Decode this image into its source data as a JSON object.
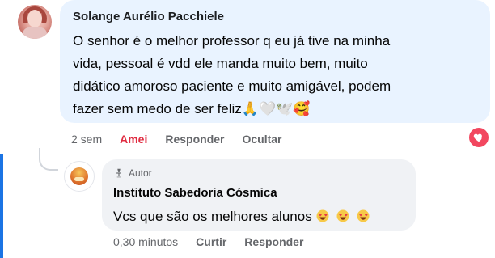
{
  "comment": {
    "author": "Solange Aurélio Pacchiele",
    "text": "O senhor é o melhor professor q eu já tive na minha\nvida, pessoal é vdd ele manda muito bem, muito\ndidático amoroso paciente e muito amigável, podem\nfazer sem medo de ser feliz🙏🤍🕊️🥰",
    "time": "2 sem",
    "reaction_label": "Amei",
    "reply_label": "Responder",
    "hide_label": "Ocultar",
    "reaction_icon": "heart-icon",
    "reaction_color": "#f2475f"
  },
  "reply": {
    "badge_label": "Autor",
    "badge_icon": "microphone-icon",
    "author": "Instituto Sabedoria Cósmica",
    "text": "Vcs que são os melhores alunos",
    "emoji_icons": [
      "heart-eyes-emoji-icon",
      "heart-eyes-emoji-icon",
      "heart-eyes-emoji-icon"
    ],
    "time": "0,30 minutos",
    "like_label": "Curtir",
    "reply_label": "Responder"
  }
}
